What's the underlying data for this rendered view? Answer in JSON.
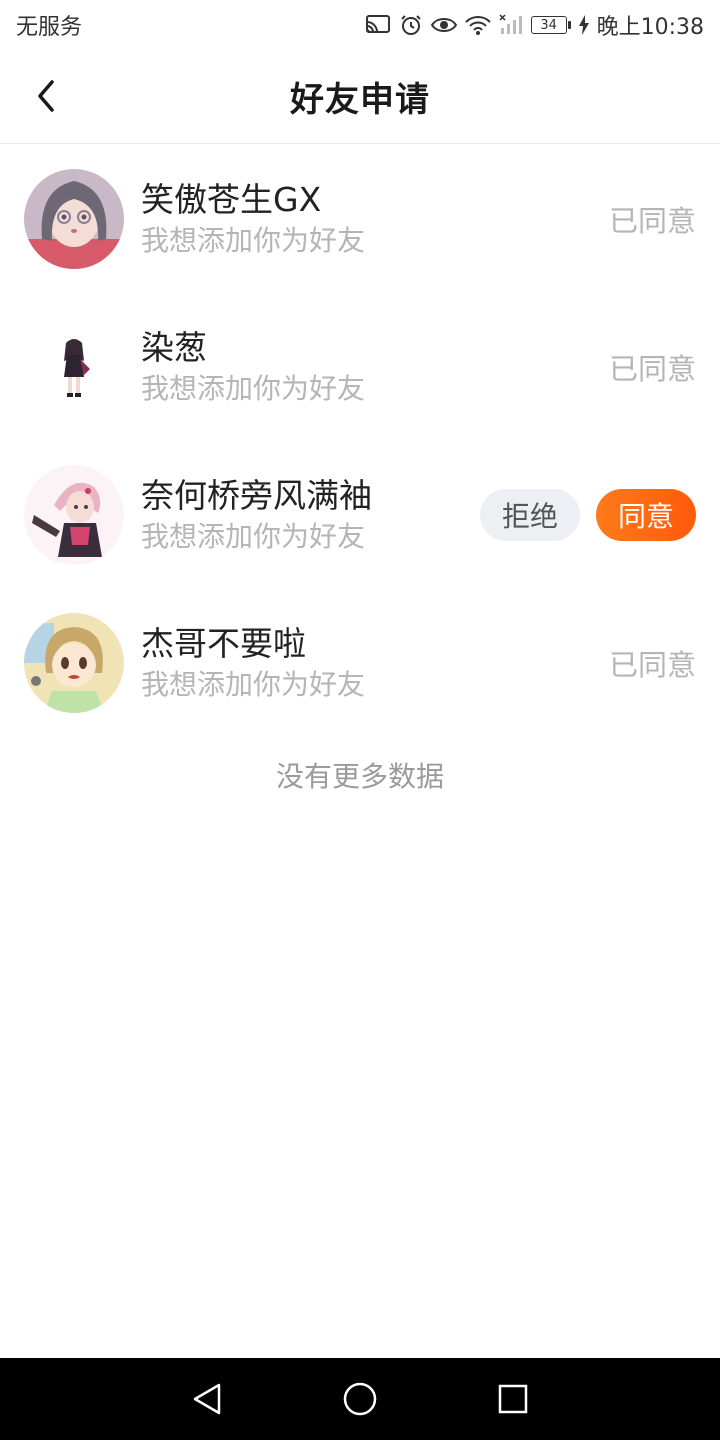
{
  "status_bar": {
    "carrier": "无服务",
    "battery": "34",
    "time": "晚上10:38",
    "icons": [
      "cast-icon",
      "alarm-icon",
      "eye-icon",
      "wifi-icon",
      "signal-icon",
      "battery-icon",
      "charging-icon"
    ]
  },
  "header": {
    "title": "好友申请",
    "back_icon": "chevron-left-icon"
  },
  "requests": [
    {
      "name": "笑傲苍生GX",
      "message": "我想添加你为好友",
      "status": "已同意"
    },
    {
      "name": "染葱",
      "message": "我想添加你为好友",
      "status": "已同意"
    },
    {
      "name": "奈何桥旁风满袖",
      "message": "我想添加你为好友",
      "reject_label": "拒绝",
      "accept_label": "同意"
    },
    {
      "name": "杰哥不要啦",
      "message": "我想添加你为好友",
      "status": "已同意"
    }
  ],
  "footer_text": "没有更多数据",
  "nav_bar": {
    "icons": [
      "back-triangle-icon",
      "home-circle-icon",
      "recents-square-icon"
    ]
  },
  "colors": {
    "accent": "#ff6a10",
    "reject_bg": "#eceff4",
    "muted_text": "#b5b5b5"
  }
}
